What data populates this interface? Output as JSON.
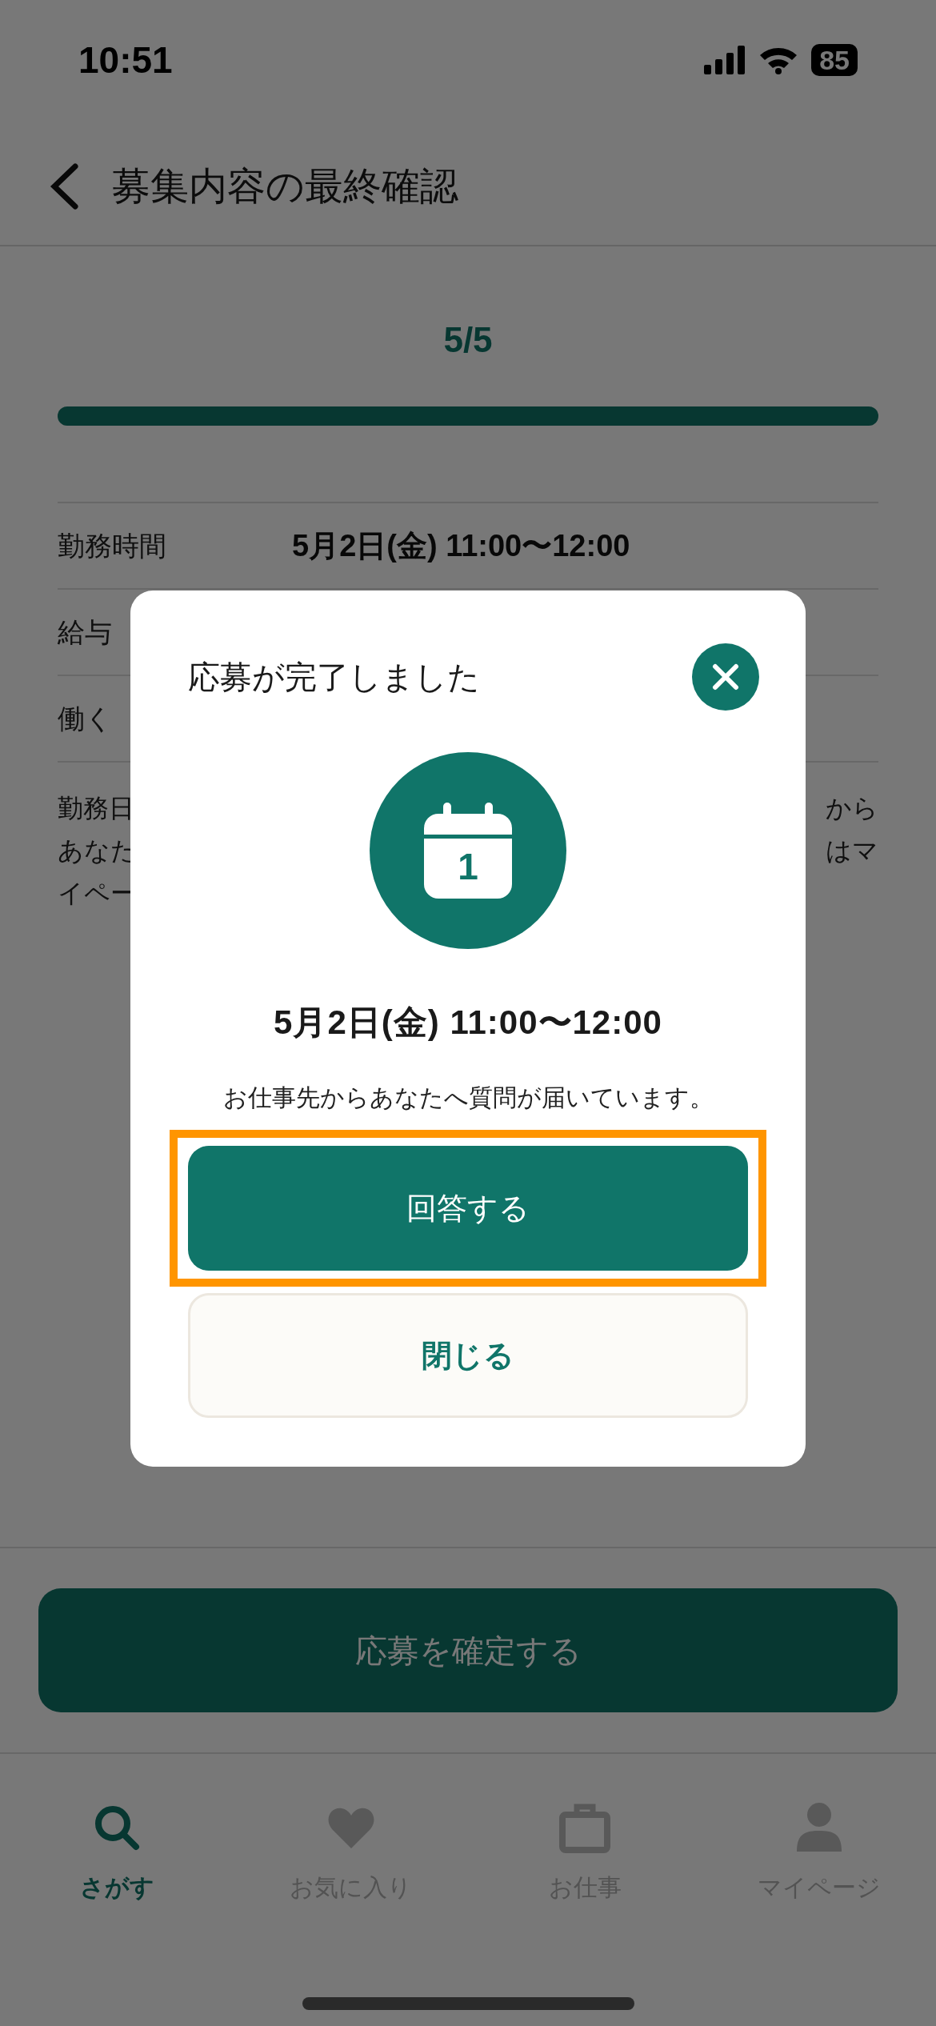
{
  "status_bar": {
    "time": "10:51",
    "battery": "85"
  },
  "header": {
    "title": "募集内容の最終確認"
  },
  "progress": {
    "label": "5/5",
    "level": 1
  },
  "details": [
    {
      "label": "勤務時間",
      "value": "5月2日(金) 11:00〜12:00"
    },
    {
      "label": "給与"
    },
    {
      "label": "働く"
    }
  ],
  "note_lines": [
    {
      "left": "勤務日",
      "right": "から"
    },
    {
      "left": "あなた",
      "right": "はマ"
    },
    {
      "left": "イペー"
    }
  ],
  "confirm_button": "応募を確定する",
  "nav": [
    {
      "label": "さがす",
      "kind": "search",
      "selected": true
    },
    {
      "label": "お気に入り",
      "kind": "heart",
      "selected": false
    },
    {
      "label": "お仕事",
      "kind": "briefcase",
      "selected": false
    },
    {
      "label": "マイページ",
      "kind": "person",
      "selected": false
    }
  ],
  "dialog": {
    "title": "応募が完了しました",
    "calendar_day": "1",
    "date": "5月2日(金) 11:00〜12:00",
    "message": "お仕事先からあなたへ質問が届いています。",
    "buttons": [
      {
        "label": "回答する",
        "kind": "primary",
        "highlighted": true
      },
      {
        "label": "閉じる",
        "kind": "secondary",
        "highlighted": false
      }
    ]
  }
}
